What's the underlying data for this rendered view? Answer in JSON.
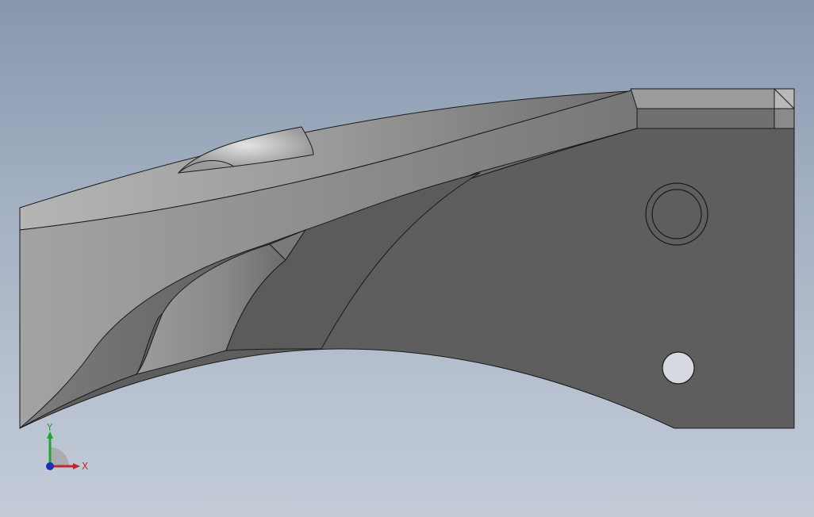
{
  "viewport": {
    "background_top": "#8797ad",
    "background_bottom": "#c4ccd8"
  },
  "model": {
    "face_color": "#5e5e5e",
    "edge_color": "#1a1a1a"
  },
  "triad": {
    "x_label": "X",
    "y_label": "Y",
    "x_color": "#c0282d",
    "y_color": "#22a33a",
    "z_color": "#1c2fb0"
  }
}
